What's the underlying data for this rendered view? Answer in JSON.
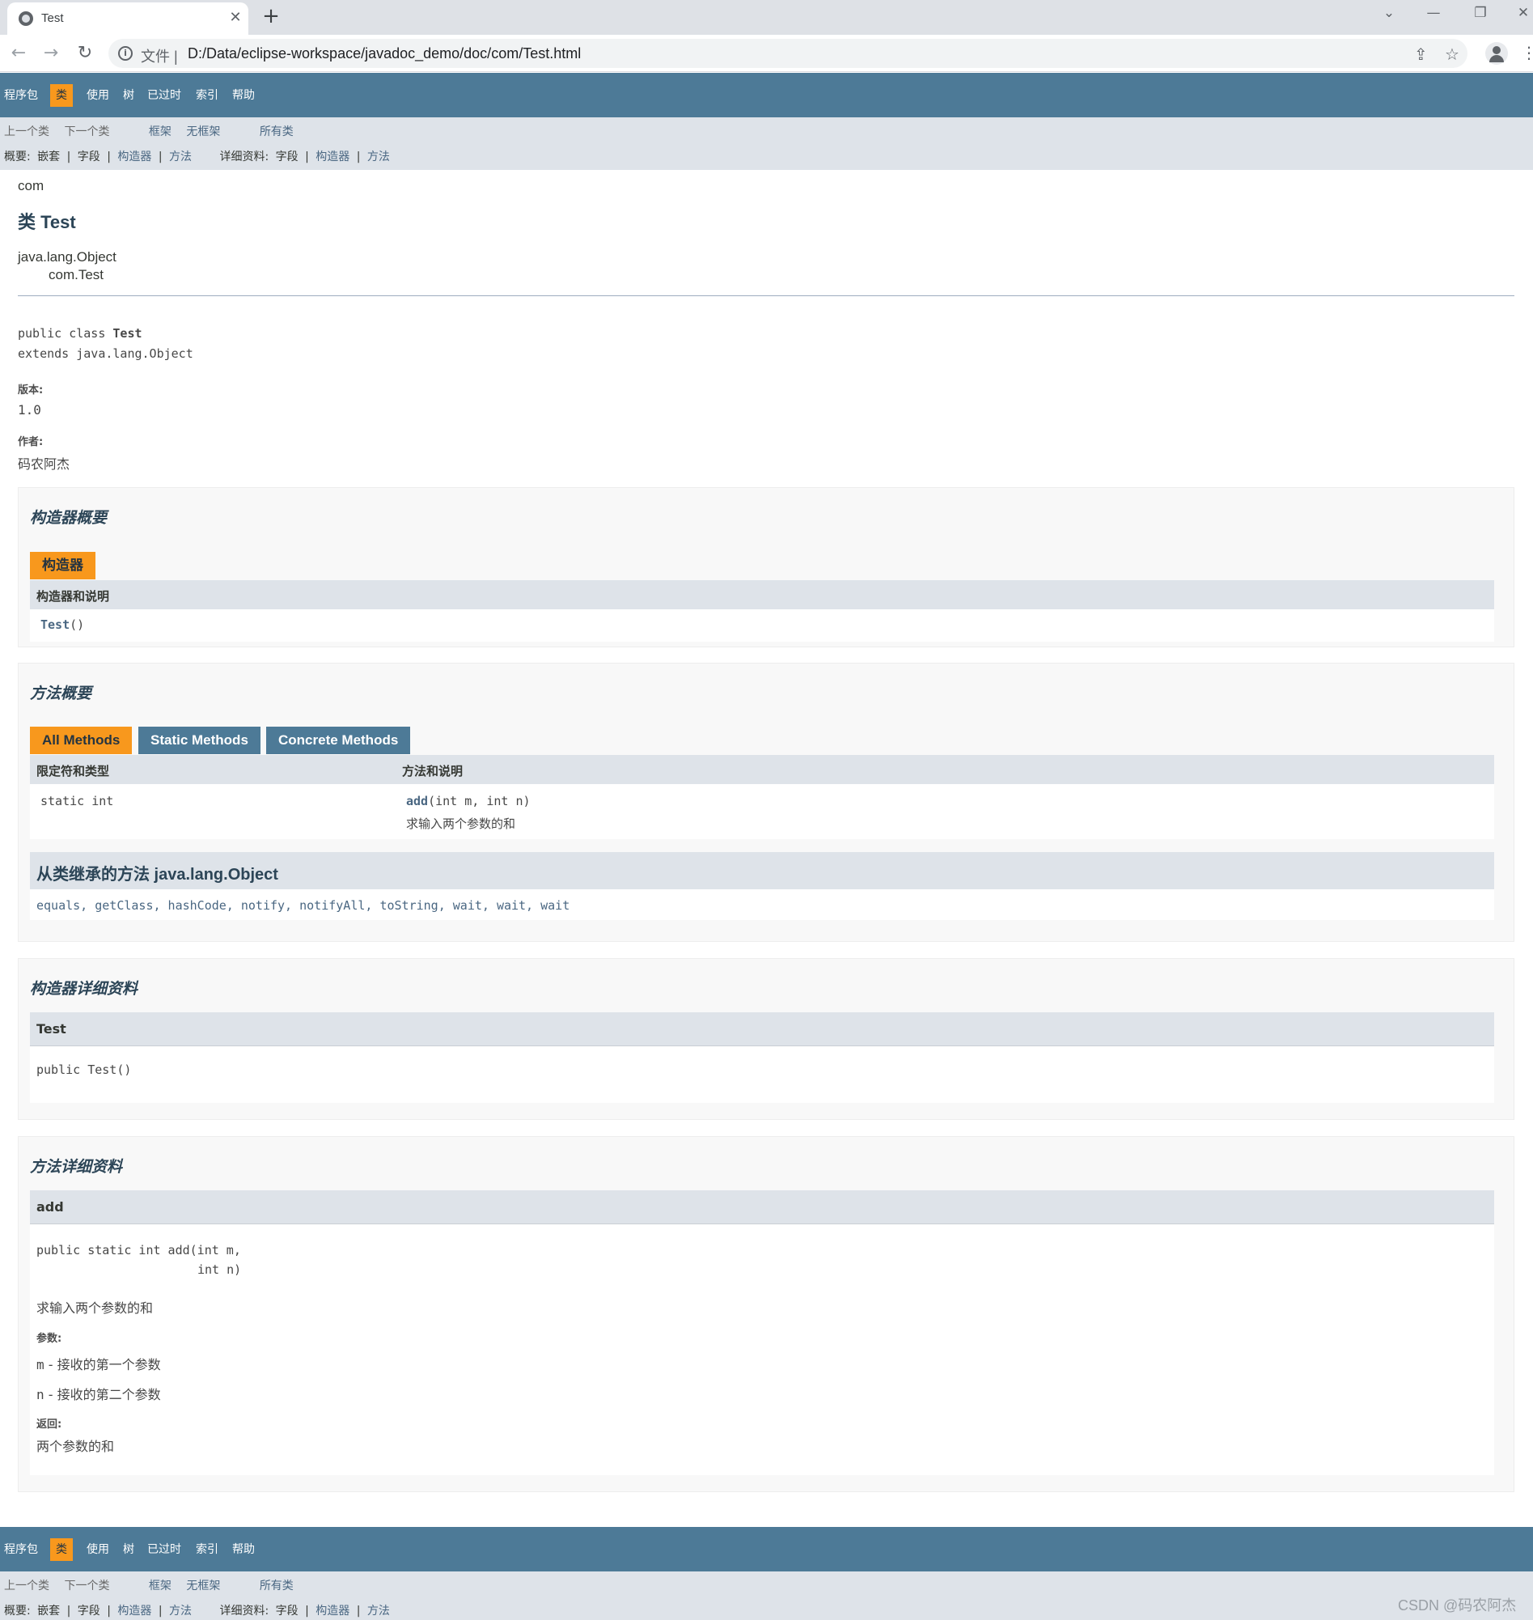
{
  "browser": {
    "tab_title": "Test",
    "url_prefix": "文件 |",
    "url": "D:/Data/eclipse-workspace/javadoc_demo/doc/com/Test.html"
  },
  "nav": {
    "items": [
      "程序包",
      "类",
      "使用",
      "树",
      "已过时",
      "索引",
      "帮助"
    ],
    "current": "类",
    "prev_class": "上一个类",
    "next_class": "下一个类",
    "frames": "框架",
    "no_frames": "无框架",
    "all_classes": "所有类",
    "summary_label": "概要:",
    "summary_nested": "嵌套",
    "summary_field": "字段",
    "summary_constr": "构造器",
    "summary_method": "方法",
    "detail_label": "详细资料:",
    "detail_field": "字段",
    "detail_constr": "构造器",
    "detail_method": "方法",
    "sep": "|"
  },
  "header": {
    "package": "com",
    "title": "类 Test",
    "inheritance_root": "java.lang.Object",
    "inheritance_child": "com.Test"
  },
  "description": {
    "sig_line1_prefix": "public class ",
    "sig_line1_name": "Test",
    "sig_line2": "extends java.lang.Object",
    "version_label": "版本:",
    "version_value": "1.0",
    "author_label": "作者:",
    "author_value": "码农阿杰"
  },
  "constructor_summary": {
    "heading": "构造器概要",
    "tab": "构造器",
    "col_header": "构造器和说明",
    "row_name": "Test",
    "row_params": "()"
  },
  "method_summary": {
    "heading": "方法概要",
    "tabs": [
      "All Methods",
      "Static Methods",
      "Concrete Methods"
    ],
    "col_modifier": "限定符和类型",
    "col_method": "方法和说明",
    "row_modifier": "static int",
    "row_name": "add",
    "row_params": "(int  m,  int  n)",
    "row_desc": "求输入两个参数的和",
    "inherited_heading": "从类继承的方法 java.lang.Object",
    "inherited_list": "equals, getClass, hashCode, notify, notifyAll, toString, wait, wait, wait"
  },
  "constructor_detail": {
    "heading": "构造器详细资料",
    "name": "Test",
    "signature": "public  Test()"
  },
  "method_detail": {
    "heading": "方法详细资料",
    "name": "add",
    "sig_line1": "public static  int  add(int  m,",
    "sig_line2": "int  n)",
    "desc": "求输入两个参数的和",
    "params_label": "参数:",
    "param1_name": "m",
    "param1_desc": " - 接收的第一个参数",
    "param2_name": "n",
    "param2_desc": " - 接收的第二个参数",
    "returns_label": "返回:",
    "returns_value": "两个参数的和"
  },
  "watermark": "CSDN @码农阿杰",
  "colors": {
    "nav_bg": "#4d7a97",
    "subnav_bg": "#dee3e9",
    "accent": "#f8981d",
    "link": "#4a6782"
  }
}
